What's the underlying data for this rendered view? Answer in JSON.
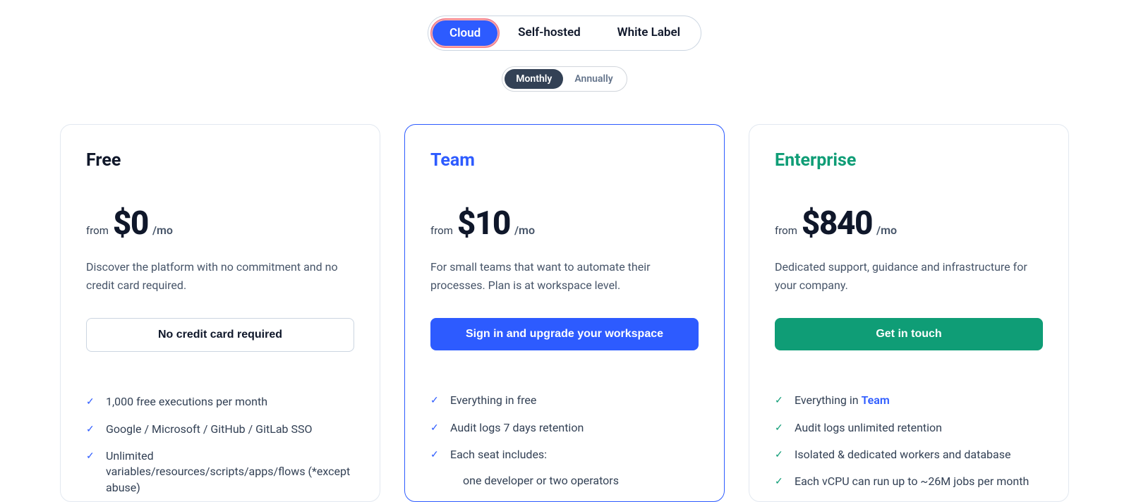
{
  "deploy": {
    "options": [
      "Cloud",
      "Self-hosted",
      "White Label"
    ],
    "active": "Cloud"
  },
  "billing": {
    "options": [
      "Monthly",
      "Annually"
    ],
    "active": "Monthly"
  },
  "plans": {
    "free": {
      "name": "Free",
      "from": "from",
      "price": "$0",
      "per": "/mo",
      "desc": "Discover the platform with no commitment and no credit card required.",
      "cta": "No credit card required",
      "features": [
        "1,000 free executions per month",
        "Google / Microsoft / GitHub / GitLab SSO",
        "Unlimited variables/resources/scripts/apps/flows (*except abuse)"
      ]
    },
    "team": {
      "name": "Team",
      "from": "from",
      "price": "$10",
      "per": "/mo",
      "desc": "For small teams that want to automate their processes. Plan is at workspace level.",
      "cta": "Sign in and upgrade your workspace",
      "features": [
        "Everything in free",
        "Audit logs 7 days retention",
        "Each seat includes:"
      ],
      "sub_features": [
        "one developer or two operators"
      ]
    },
    "enterprise": {
      "name": "Enterprise",
      "from": "from",
      "price": "$840",
      "per": "/mo",
      "desc": "Dedicated support, guidance and infrastructure for your company.",
      "cta": "Get in touch",
      "feature_prefix": "Everything in ",
      "feature_link": "Team",
      "features_rest": [
        "Audit logs unlimited retention",
        "Isolated & dedicated workers and database",
        "Each vCPU can run up to ~26M jobs per month"
      ]
    }
  }
}
